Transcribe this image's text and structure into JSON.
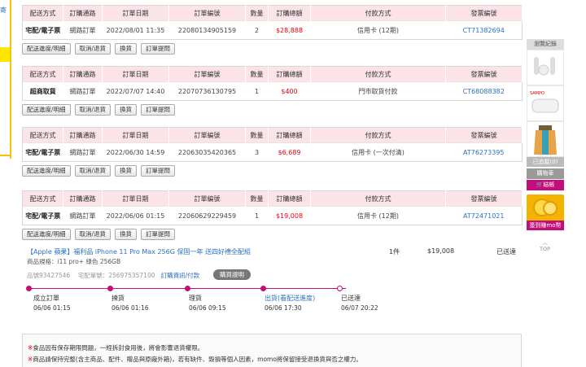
{
  "left_fragment": "寄",
  "table_headers": [
    "配送方式",
    "訂購通路",
    "訂單日期",
    "訂單編號",
    "數量",
    "訂購總額",
    "付款方式",
    "發票編號"
  ],
  "orders": [
    {
      "ship": "宅配/電子票",
      "channel": "網路訂單",
      "date": "2022/08/01 11:35",
      "order_no": "22080134905159",
      "qty": "2",
      "total": "$28,888",
      "payment": "信用卡 (12期)",
      "invoice": "CT71382694",
      "buttons": [
        "配送進度/明細",
        "取消/退貨",
        "換貨",
        "訂單提問"
      ]
    },
    {
      "ship": "超商取貨",
      "channel": "網路訂單",
      "date": "2022/07/07 14:40",
      "order_no": "22070736130795",
      "qty": "1",
      "total": "$400",
      "payment": "門市取貨付款",
      "invoice": "CT68088382",
      "buttons": [
        "配送進度/明細",
        "取消/退貨",
        "換貨",
        "訂單提問"
      ]
    },
    {
      "ship": "宅配/電子票",
      "channel": "網路訂單",
      "date": "2022/06/30 14:59",
      "order_no": "22063035420365",
      "qty": "3",
      "total": "$6,689",
      "payment": "信用卡 (一次付清)",
      "invoice": "AT76273395",
      "buttons": [
        "配送進度/明細",
        "取消/退貨",
        "換貨",
        "訂單提問"
      ]
    },
    {
      "ship": "宅配/電子票",
      "channel": "網路訂單",
      "date": "2022/06/06 01:15",
      "order_no": "22060629229459",
      "qty": "1",
      "total": "$19,008",
      "payment": "信用卡 (12期)",
      "invoice": "AT72471021",
      "buttons": [
        "配送進度/明細",
        "取消/退貨",
        "換貨",
        "訂單提問"
      ]
    }
  ],
  "detail": {
    "product_title": "【Apple 蘋果】福利品 iPhone 11 Pro Max 256G 保固一年 送四好禮全配組",
    "spec": "商品規格：i11 pro+ 綠色 256GB",
    "qty": "1件",
    "price": "$19,008",
    "status": "已送達",
    "item_no_label": "品號93427546",
    "delivery_no_label": "宅配單號：256975357100",
    "invoice_link": "訂購資訊/付款",
    "buy_note": "購買證明",
    "timeline": [
      {
        "label": "成立訂單",
        "time": "06/06 01:15",
        "link": false
      },
      {
        "label": "揀貨",
        "time": "06/06 01:16",
        "link": false
      },
      {
        "label": "理貨",
        "time": "06/06 09:15",
        "link": false
      },
      {
        "label": "出貨(看配送進度)",
        "time": "06/06 17:30",
        "link": true
      },
      {
        "label": "已送達",
        "time": "06/07 20:22",
        "link": false
      }
    ]
  },
  "notice": [
    "食品因有保存期限問題，一經拆封食用後，將會影響退貨權限。",
    "商品請保持完整(含主商品、配件、贈品與原廠外箱)，若有缺件、毀損等個人因素，momo將保留接受退換貨與否之權力。"
  ],
  "sidebar": {
    "recent_header": "瀏覽紀錄",
    "recent_count": "已追蹤(0)",
    "cart_label": "購物車",
    "cart_sub": "結帳",
    "promo_label": "簽到賺mo幣",
    "top_label": "TOP"
  }
}
